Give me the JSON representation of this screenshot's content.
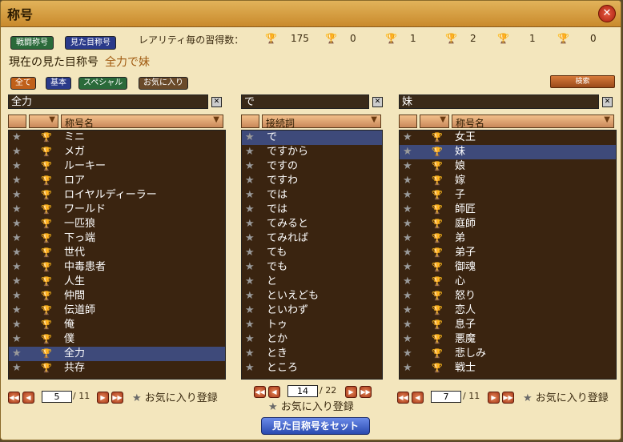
{
  "window": {
    "title": "称号",
    "close": "✕"
  },
  "tabs": [
    {
      "label": "戦闘称号",
      "color": "#2a6a3a"
    },
    {
      "label": "見た目称号",
      "color": "#2a3a8a"
    }
  ],
  "counts": {
    "label": "レアリティ毎の習得数：",
    "values": [
      "175",
      "0",
      "1",
      "2",
      "1",
      "0"
    ]
  },
  "current": {
    "label": "現在の見た目称号",
    "value": "全力で妹"
  },
  "filters": [
    {
      "label": "全て",
      "color": "#c0601a"
    },
    {
      "label": "基本",
      "color": "#2a3a8a"
    },
    {
      "label": "スペシャル",
      "color": "#2a6a3a"
    },
    {
      "label": "お気に入り",
      "color": "#6a4a2a"
    }
  ],
  "search_label": "検索",
  "panels": [
    {
      "input": "全力",
      "header": "称号名",
      "items": [
        "ミニ",
        "メガ",
        "ルーキー",
        "ロア",
        "ロイヤルディーラー",
        "ワールド",
        "一匹狼",
        "下っ端",
        "世代",
        "中毒患者",
        "人生",
        "仲間",
        "伝道師",
        "俺",
        "僕",
        "全力",
        "共存"
      ],
      "selected": 15,
      "page": "5",
      "total": "/ 11",
      "fav": "お気に入り登録"
    },
    {
      "input": "で",
      "header": "接続詞",
      "items": [
        "で",
        "ですから",
        "ですの",
        "ですわ",
        "では",
        "では",
        "てみると",
        "てみれば",
        "ても",
        "でも",
        "と",
        "といえども",
        "といわず",
        "トゥ",
        "とか",
        "とき",
        "ところ"
      ],
      "selected": 0,
      "page": "14",
      "total": "/ 22",
      "fav": "お気に入り登録"
    },
    {
      "input": "妹",
      "header": "称号名",
      "items": [
        "女王",
        "妹",
        "娘",
        "嫁",
        "子",
        "師匠",
        "庭師",
        "弟",
        "弟子",
        "御魂",
        "心",
        "怒り",
        "恋人",
        "息子",
        "悪魔",
        "悲しみ",
        "戦士"
      ],
      "selected": 1,
      "page": "7",
      "total": "/ 11",
      "fav": "お気に入り登録"
    }
  ],
  "set_button": "見た目称号をセット"
}
